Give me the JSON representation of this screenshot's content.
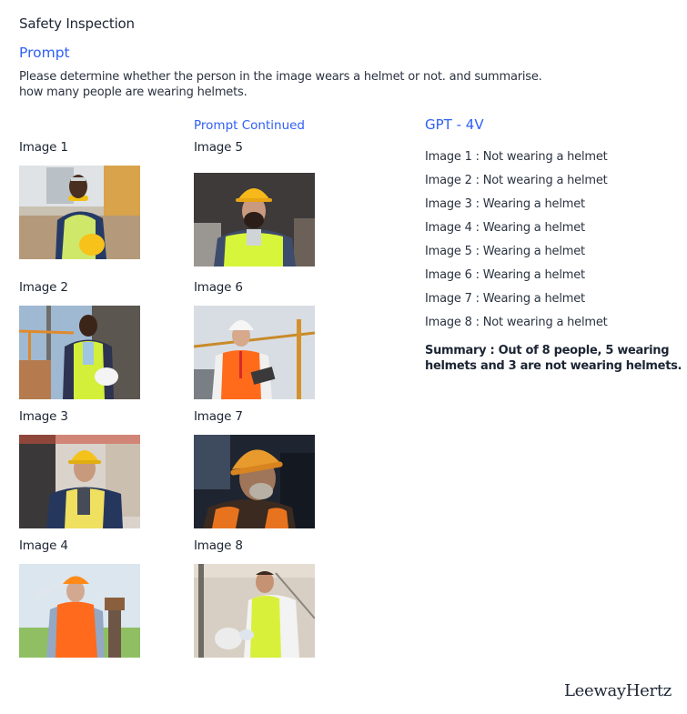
{
  "page": {
    "title": "Safety Inspection",
    "prompt_heading": "Prompt",
    "prompt_lines": [
      "Please determine whether the person in the image wears a helmet or not. and summarise.",
      "how many people are wearing helmets."
    ],
    "prompt_continued_heading": "Prompt Continued"
  },
  "images": [
    {
      "label": "Image 1",
      "description": "Worker in hi-vis vest holding yellow helmet, earmuffs around neck"
    },
    {
      "label": "Image 2",
      "description": "Smiling worker in hi-vis vest holding white helmet"
    },
    {
      "label": "Image 3",
      "description": "Worker with yellow hard hat, arms crossed in warehouse"
    },
    {
      "label": "Image 4",
      "description": "Worker in orange vest adjusting orange hard hat"
    },
    {
      "label": "Image 5",
      "description": "Bearded worker with yellow hard hat, arms crossed"
    },
    {
      "label": "Image 6",
      "description": "Engineer with white hard hat writing on clipboard near crane"
    },
    {
      "label": "Image 7",
      "description": "Older worker with orange hard hat at dusk"
    },
    {
      "label": "Image 8",
      "description": "Worker in hi-vis vest holding white helmet indoors"
    }
  ],
  "gpt": {
    "heading": "GPT - 4V",
    "results": [
      "Image 1 : Not wearing a helmet",
      "Image 2 : Not wearing a helmet",
      "Image 3 : Wearing a helmet",
      "Image 4 : Wearing a helmet",
      "Image 5 : Wearing a helmet",
      "Image 6 : Wearing a helmet",
      "Image 7 : Wearing a helmet",
      "Image 8 : Not wearing a helmet"
    ],
    "summary_lines": [
      "Summary : Out of 8 people, 5 wearing",
      "helmets and 3 are not wearing helmets."
    ]
  },
  "brand": {
    "logo_text": "LeewayHertz"
  },
  "colors": {
    "accent_blue": "#2f5ff5",
    "text_dark": "#1c2533"
  }
}
